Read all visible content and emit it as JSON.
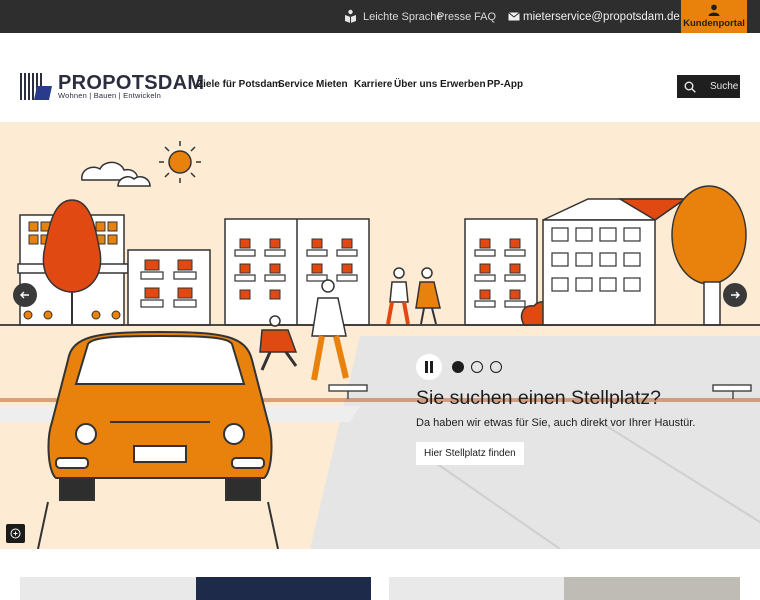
{
  "topbar": {
    "easy_language": "Leichte Sprache",
    "press": "Presse",
    "faq": "FAQ",
    "email": "mieterservice@propotsdam.de",
    "portal": "Kundenportal"
  },
  "logo": {
    "name_part1": "Pro",
    "name_part2": "Potsdam",
    "tagline": "Wohnen | Bauen | Entwickeln"
  },
  "nav": {
    "items": [
      "Ziele für Potsdam",
      "Service",
      "Mieten",
      "Karriere",
      "Über uns",
      "Erwerben",
      "PP-App"
    ]
  },
  "search": {
    "label": "Suche"
  },
  "hero": {
    "title": "Sie suchen einen Stellplatz?",
    "subtitle": "Da haben wir etwas für Sie, auch direkt vor Ihrer Haustür.",
    "cta": "Hier Stellplatz finden",
    "slides_total": 3,
    "active_slide": 1
  },
  "colors": {
    "accent": "#e8820c",
    "brand_dark": "#2b2e3f",
    "hero_bg": "#fdebd3",
    "topbar_bg": "#2e2e2e"
  }
}
